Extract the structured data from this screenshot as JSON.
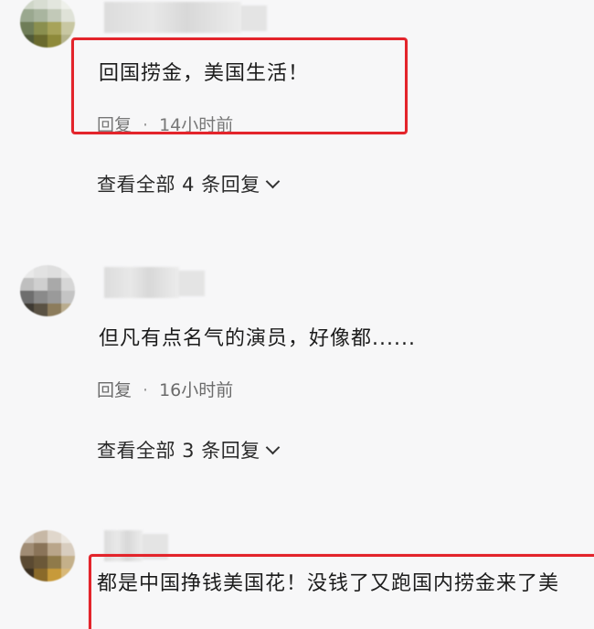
{
  "comments": [
    {
      "text": "回国捞金，美国生活！",
      "reply_label": "回复",
      "separator": "·",
      "time": "14小时前",
      "view_replies": "查看全部 4 条回复"
    },
    {
      "text": "但凡有点名气的演员，好像都......",
      "reply_label": "回复",
      "separator": "·",
      "time": "16小时前",
      "view_replies": "查看全部 3 条回复"
    },
    {
      "text": "都是中国挣钱美国花！没钱了又跑国内捞金来了美"
    }
  ],
  "colors": {
    "highlight": "#e3242b",
    "background": "#f7f7f8"
  },
  "icons": {
    "expand": "chevron-down-icon"
  }
}
